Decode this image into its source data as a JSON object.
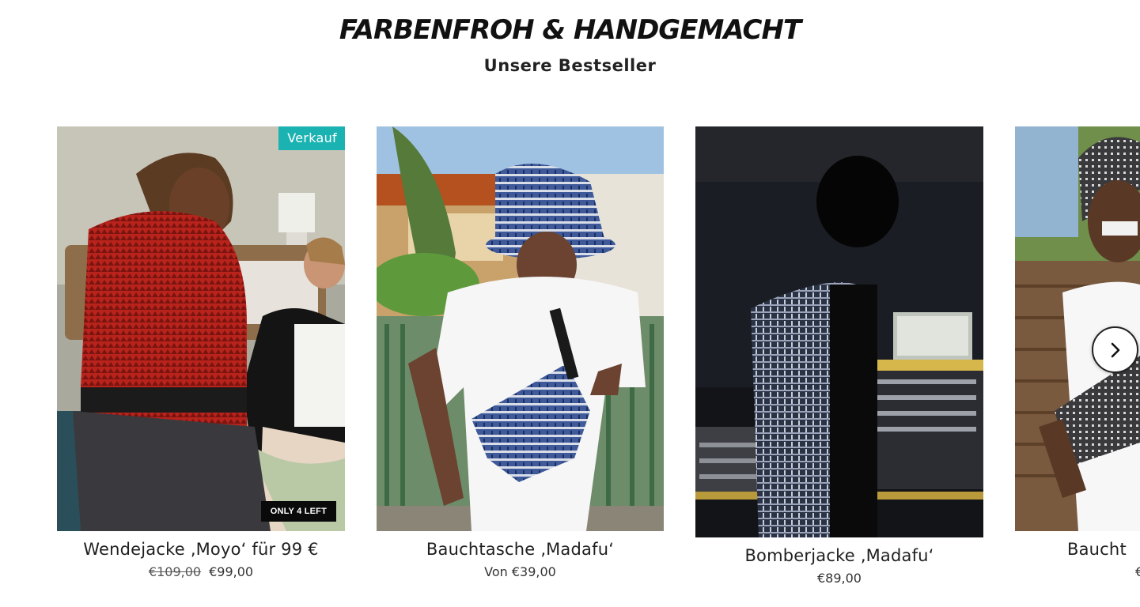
{
  "section": {
    "title": "FARBENFROH & HANDGEMACHT",
    "subtitle": "Unsere Bestseller"
  },
  "colors": {
    "sale_badge": "#1bb3b2",
    "stock_badge": "#0a0a0a"
  },
  "products": [
    {
      "title": "Wendejacke ‚Moyo‘ für 99 €",
      "price_old": "€109,00",
      "price": "€99,00",
      "badge": "Verkauf",
      "stock_label": "ONLY 4 LEFT",
      "image": "woman-red-reversible-jacket-photo"
    },
    {
      "title": "Bauchtasche ‚Madafu‘",
      "price": "Von €39,00",
      "image": "man-bucket-hat-belt-bag-photo"
    },
    {
      "title": "Bomberjacke ‚Madafu‘",
      "price": "€89,00",
      "image": "man-bomber-jacket-studio-photo"
    },
    {
      "title": "Baucht",
      "price": "€",
      "image": "smiling-man-belt-bag-photo"
    }
  ],
  "carousel": {
    "next_icon": "chevron-right-icon"
  }
}
